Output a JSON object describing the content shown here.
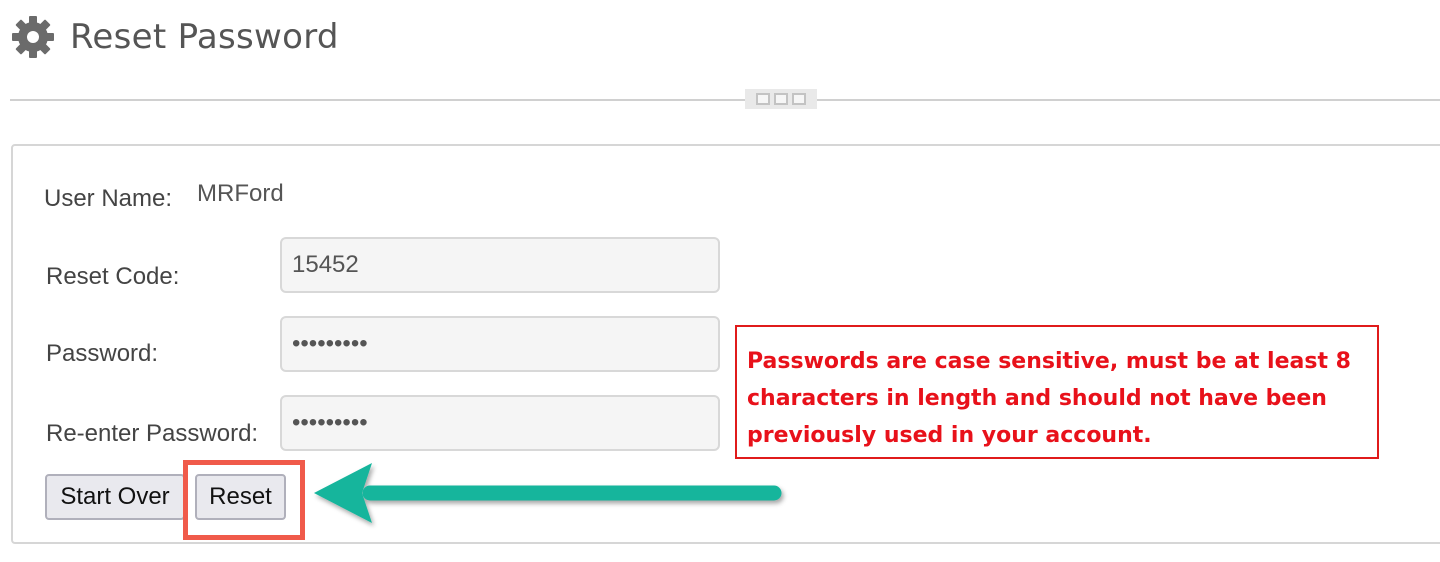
{
  "header": {
    "title": "Reset Password",
    "icon": "gear-icon"
  },
  "form": {
    "username_label": "User Name:",
    "username_value": "MRFord",
    "reset_code_label": "Reset Code:",
    "reset_code_value": "15452",
    "password_label": "Password:",
    "password_value": "•••••••••",
    "reenter_label": "Re-enter Password:",
    "reenter_value": "•••••••••"
  },
  "note": {
    "line1": "Passwords are case sensitive, must be at least 8",
    "line2": "characters in length and should not have been",
    "line3": "previously used in your account."
  },
  "buttons": {
    "start_over": "Start Over",
    "reset": "Reset"
  },
  "colors": {
    "note_text": "#e8111a",
    "highlight": "#f05a4a",
    "arrow": "#12b59c"
  }
}
